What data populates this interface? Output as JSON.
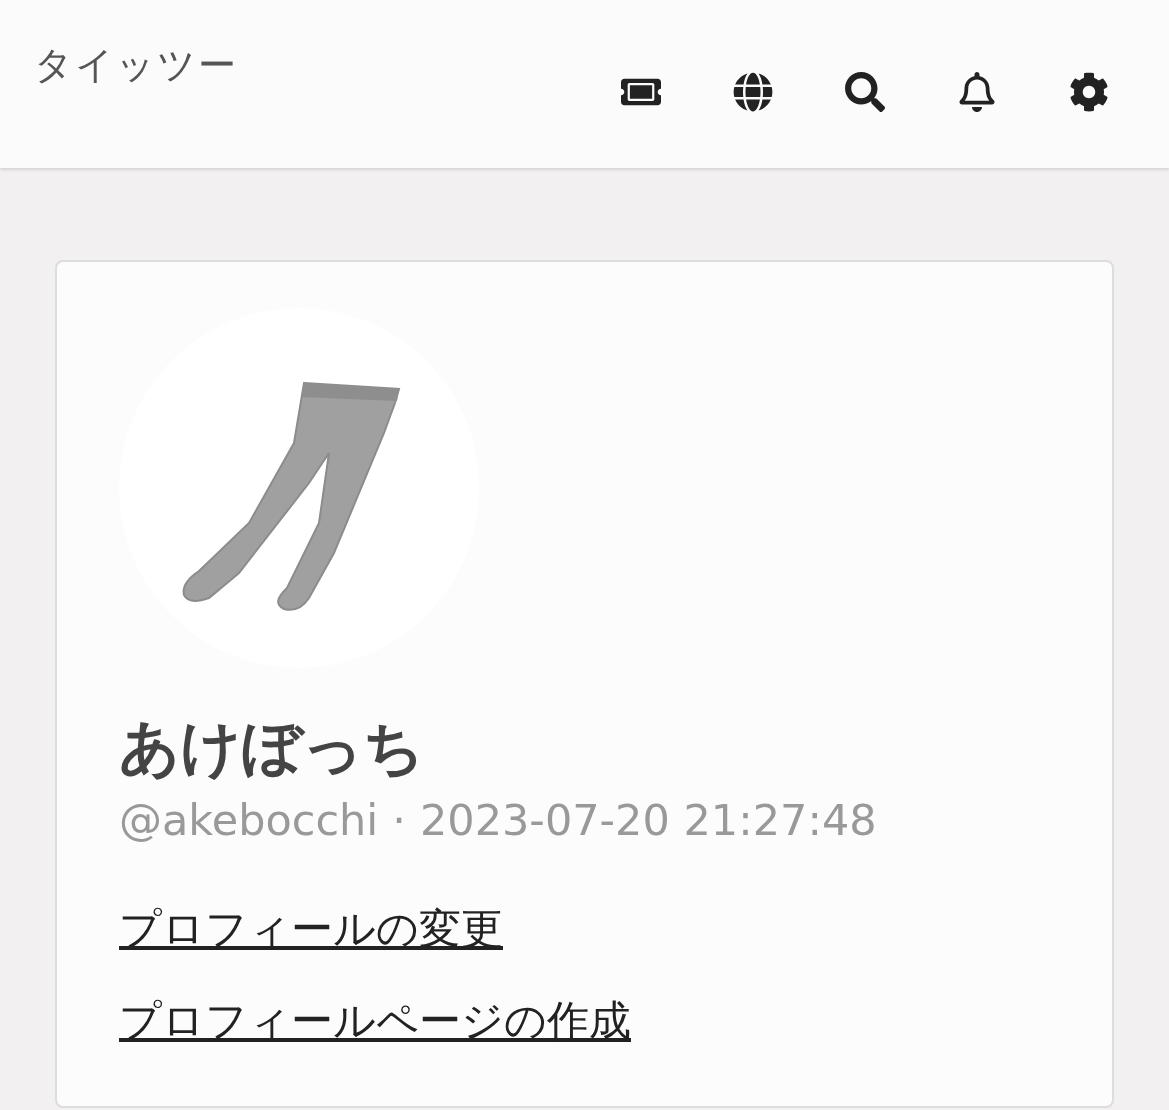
{
  "header": {
    "title": "タイッツー"
  },
  "profile": {
    "name": "あけぼっち",
    "handle": "@akebocchi",
    "separator": "·",
    "joined": "2023-07-20 21:27:48"
  },
  "links": [
    {
      "label": "プロフィールの変更"
    },
    {
      "label": "プロフィールページの作成"
    }
  ]
}
